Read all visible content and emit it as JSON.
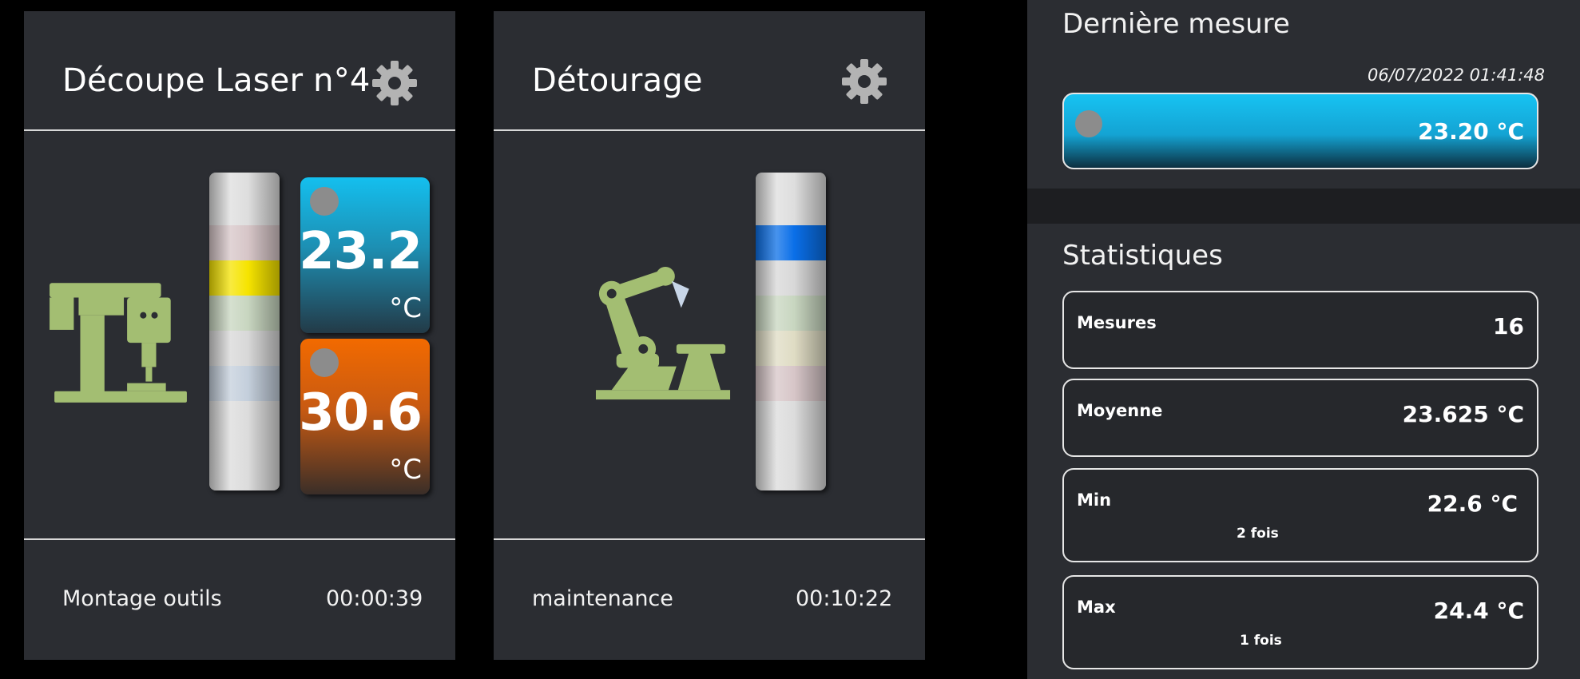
{
  "cards": [
    {
      "title": "Découpe Laser n°4",
      "status": "Montage outils",
      "timer": "00:00:39",
      "temperatures": [
        {
          "value": "23.2",
          "unit": "°C",
          "color": "#14b8e6"
        },
        {
          "value": "30.6",
          "unit": "°C",
          "color": "#f07000"
        }
      ]
    },
    {
      "title": "Détourage",
      "status": "maintenance",
      "timer": "00:10:22"
    }
  ],
  "last_measure": {
    "heading": "Dernière mesure",
    "timestamp": "06/07/2022 01:41:48",
    "value": "23.20 °C",
    "accent": "#13b6e4"
  },
  "statistics": {
    "heading": "Statistiques",
    "rows": [
      {
        "label": "Mesures",
        "value": "16",
        "sub": ""
      },
      {
        "label": "Moyenne",
        "value": "23.625 °C",
        "sub": ""
      },
      {
        "label": "Min",
        "value": "22.6 °C",
        "sub": "2 fois"
      },
      {
        "label": "Max",
        "value": "24.4 °C",
        "sub": "1 fois"
      }
    ]
  },
  "icons": {
    "settings": "gear-icon",
    "machine_1": "drill-press-icon",
    "machine_2": "robot-arm-icon",
    "status": "status-dot-icon"
  }
}
